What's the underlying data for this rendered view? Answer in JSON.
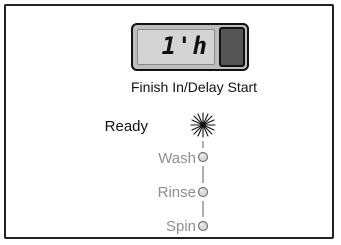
{
  "display": {
    "value": "1'h",
    "label": "Finish In/Delay Start"
  },
  "cycle_status": {
    "items": [
      {
        "label": "Ready",
        "state": "active"
      },
      {
        "label": "Wash",
        "state": "inactive"
      },
      {
        "label": "Rinse",
        "state": "inactive"
      },
      {
        "label": "Spin",
        "state": "inactive"
      }
    ]
  },
  "colors": {
    "active_text": "#111111",
    "inactive_text": "#8f8f8f",
    "display_background": "#bdbdbd"
  }
}
